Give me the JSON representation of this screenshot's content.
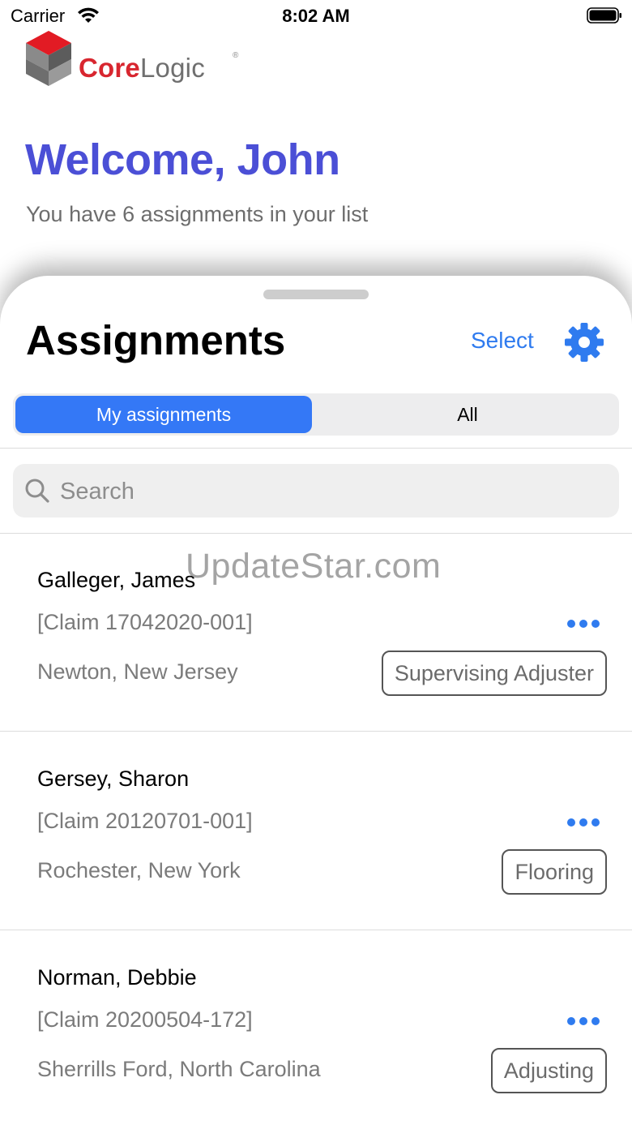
{
  "status_bar": {
    "carrier": "Carrier",
    "time": "8:02 AM"
  },
  "logo": {
    "brand_red": "Core",
    "brand_gray": "Logic",
    "tm": "®"
  },
  "welcome": {
    "title": "Welcome, John",
    "subtitle": "You have 6 assignments in your list"
  },
  "sheet": {
    "title": "Assignments",
    "select_label": "Select",
    "tabs": [
      {
        "label": "My assignments",
        "active": true
      },
      {
        "label": "All",
        "active": false
      }
    ],
    "search": {
      "placeholder": "Search",
      "value": ""
    }
  },
  "assignments": [
    {
      "name": "Galleger, James",
      "claim": "[Claim 17042020-001]",
      "location": "Newton, New Jersey",
      "role": "Supervising Adjuster"
    },
    {
      "name": "Gersey, Sharon",
      "claim": "[Claim 20120701-001]",
      "location": "Rochester, New York",
      "role": "Flooring"
    },
    {
      "name": "Norman, Debbie",
      "claim": "[Claim 20200504-172]",
      "location": "Sherrills Ford, North Carolina",
      "role": "Adjusting"
    }
  ],
  "watermark": "UpdateStar.com",
  "colors": {
    "accent": "#2f7bef",
    "segment_active": "#3478f6",
    "welcome_title": "#4b4fd6",
    "brand_red": "#d8262f"
  },
  "icons": [
    "wifi-icon",
    "battery-icon",
    "corelogic-logo-mark",
    "gear-icon",
    "search-icon",
    "more-icon"
  ]
}
